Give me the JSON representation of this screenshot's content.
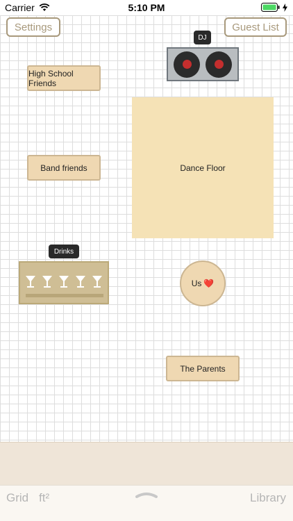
{
  "status": {
    "carrier": "Carrier",
    "time": "5:10 PM"
  },
  "header": {
    "settings": "Settings",
    "guest_list": "Guest List"
  },
  "floor": {
    "tables": [
      {
        "label": "High School Friends"
      },
      {
        "label": "Band friends"
      },
      {
        "label": "The Parents"
      }
    ],
    "dance_floor": "Dance Floor",
    "dj_tag": "DJ",
    "drinks_tag": "Drinks",
    "us_label": "Us",
    "heart": "❤️"
  },
  "toolbar": {
    "grid": "Grid",
    "units": "ft²",
    "library": "Library"
  },
  "colors": {
    "accent": "#a8997c",
    "table_fill": "#efd8b2",
    "dance_floor": "#f5e2b6"
  }
}
